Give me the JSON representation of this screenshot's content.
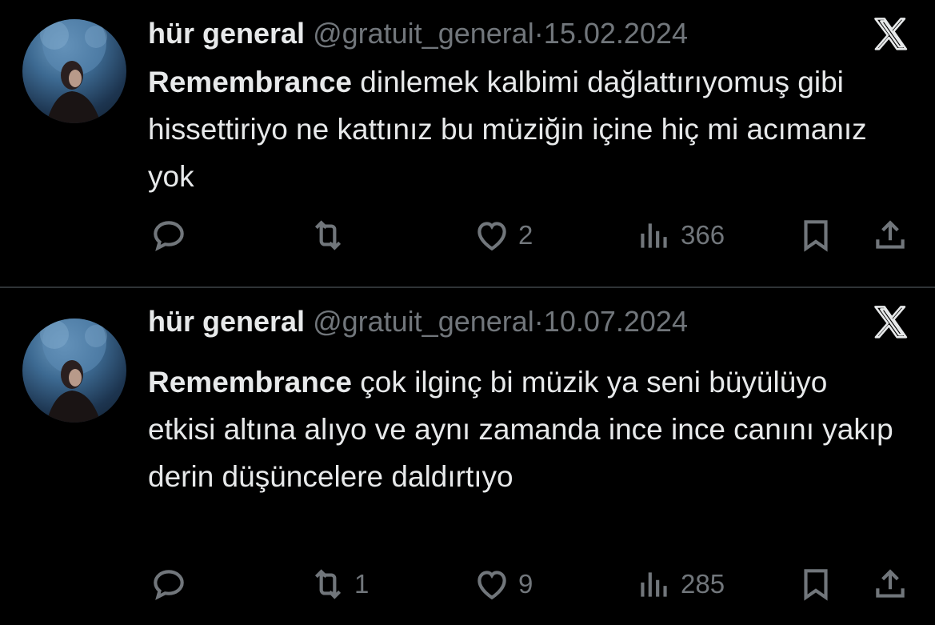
{
  "tweets": [
    {
      "name": "hür general",
      "handle": "@gratuit_general",
      "separator": "·",
      "date": "15.02.2024",
      "mention": "Remembrance",
      "text": " dinlemek kalbimi dağlattırıyomuş gibi hissettiriyo ne kattınız bu müziğin içine hiç mi acımanız yok",
      "replies": "",
      "retweets": "",
      "likes": "2",
      "views": "366"
    },
    {
      "name": "hür general",
      "handle": "@gratuit_general",
      "separator": "·",
      "date": "10.07.2024",
      "mention": "Remembrance",
      "text": " çok ilginç bi müzik ya seni büyülüyo etkisi altına alıyo ve aynı zamanda ince ince canını yakıp derin düşüncelere daldırtıyo",
      "replies": "",
      "retweets": "1",
      "likes": "9",
      "views": "285"
    }
  ],
  "icons": [
    "x-logo-icon",
    "reply-icon",
    "retweet-icon",
    "like-icon",
    "views-icon",
    "bookmark-icon",
    "share-icon"
  ],
  "colors": {
    "background": "#000000",
    "text": "#e7e9ea",
    "muted": "#71767b",
    "divider": "#2f3336"
  }
}
